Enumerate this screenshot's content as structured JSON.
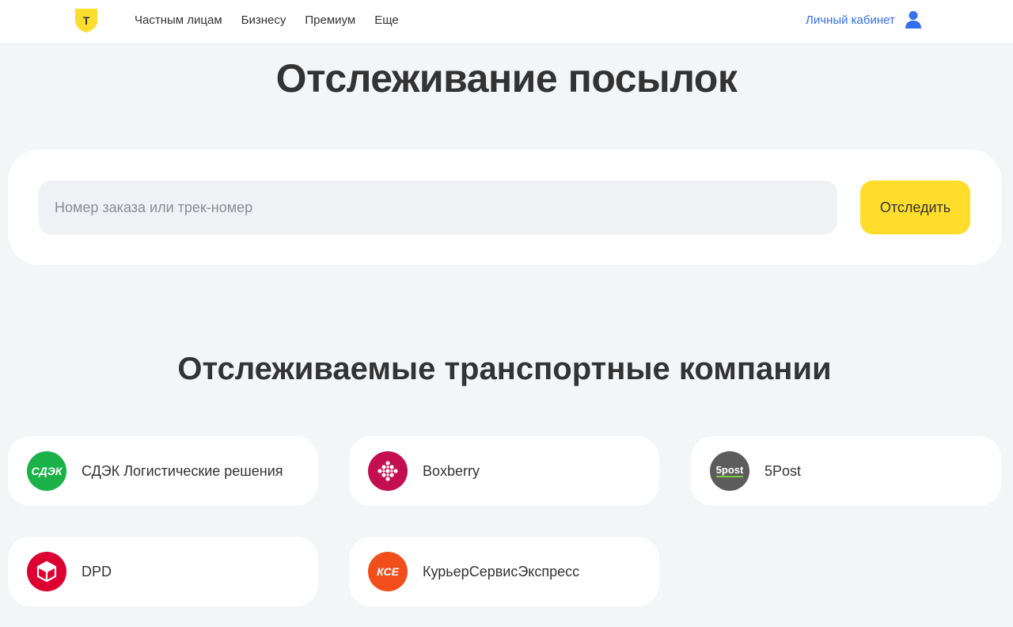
{
  "header": {
    "nav": [
      "Частным лицам",
      "Бизнесу",
      "Премиум",
      "Еще"
    ],
    "account_label": "Личный кабинет",
    "logo_letter": "T"
  },
  "main": {
    "title": "Отслеживание посылок",
    "search": {
      "placeholder": "Номер заказа или трек-номер",
      "value": "",
      "button_label": "Отследить"
    },
    "companies_title": "Отслеживаемые транспортные компании",
    "companies": [
      {
        "name": "СДЭК Логистические решения",
        "logo_text": "СДЭК",
        "icon": "cdek-logo-icon",
        "color": "#1ab248"
      },
      {
        "name": "Boxberry",
        "logo_text": "",
        "icon": "boxberry-logo-icon",
        "color": "#c30e4f"
      },
      {
        "name": "5Post",
        "logo_text": "5post",
        "icon": "5post-logo-icon",
        "color": "#5c5c5c"
      },
      {
        "name": "DPD",
        "logo_text": "",
        "icon": "dpd-logo-icon",
        "color": "#dc0032"
      },
      {
        "name": "КурьерСервисЭкспресс",
        "logo_text": "КСЕ",
        "icon": "cse-logo-icon",
        "color": "#f04e1b"
      }
    ]
  },
  "colors": {
    "accent": "#ffdd2d",
    "link": "#336fee",
    "background": "#f4f5f7"
  }
}
